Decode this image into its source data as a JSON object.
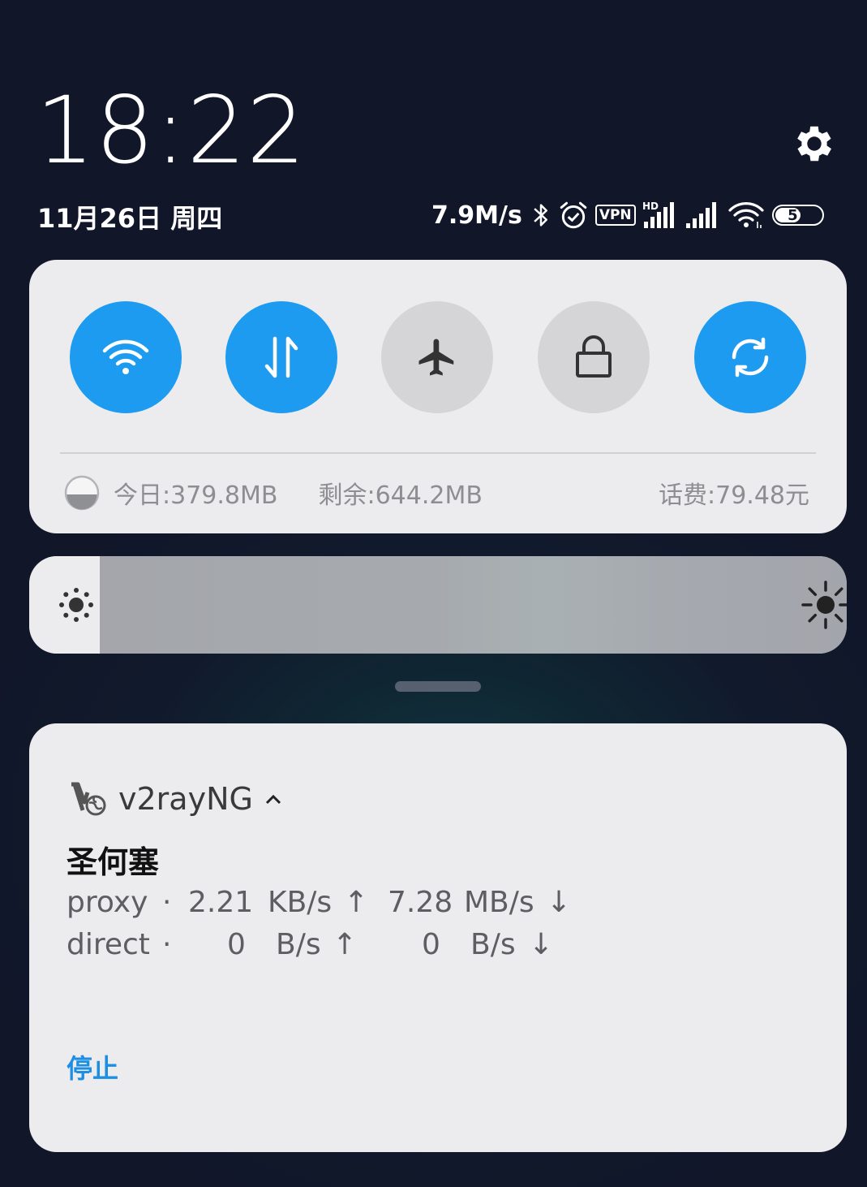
{
  "header": {
    "time": "18:22",
    "date": "11月26日 周四",
    "settings_icon": "gear-icon"
  },
  "status_bar": {
    "net_speed": "7.9M/s",
    "vpn_label": "VPN",
    "hd_label": "HD",
    "battery_level": "57",
    "battery_fraction": 0.57,
    "icons": [
      "bluetooth-icon",
      "alarm-icon",
      "vpn-icon",
      "hd-signal-icon",
      "signal-icon",
      "wifi-icon",
      "battery-icon"
    ]
  },
  "quick_settings": {
    "toggles": [
      {
        "name": "wifi",
        "icon": "wifi-icon",
        "state": "on"
      },
      {
        "name": "mobile-data",
        "icon": "data-transfer-icon",
        "state": "on"
      },
      {
        "name": "airplane",
        "icon": "airplane-icon",
        "state": "off"
      },
      {
        "name": "lock",
        "icon": "lock-icon",
        "state": "off"
      },
      {
        "name": "auto-rotate",
        "icon": "sync-icon",
        "state": "on"
      }
    ],
    "data_usage": {
      "today": "今日:379.8MB",
      "remaining": "剩余:644.2MB",
      "balance": "话费:79.48元"
    },
    "colors": {
      "on": "#1c9bf0",
      "off": "#d5d5d8"
    }
  },
  "brightness": {
    "level": 0.92,
    "low_icon": "brightness-low-icon",
    "high_icon": "brightness-high-icon"
  },
  "notification": {
    "app_name": "v2rayNG",
    "app_icon": "v2rayng-icon",
    "title": "圣何塞",
    "rows": [
      {
        "label": "proxy",
        "sep": "·",
        "up_value": "2.21",
        "up_unit": "KB/s",
        "down_value": "7.28",
        "down_unit": "MB/s"
      },
      {
        "label": "direct",
        "sep": "·",
        "up_value": "0",
        "up_unit": "B/s",
        "down_value": "0",
        "down_unit": "B/s"
      }
    ],
    "up_arrow": "↑",
    "down_arrow": "↓",
    "action_label": "停止",
    "accent": "#1c8fe3"
  }
}
